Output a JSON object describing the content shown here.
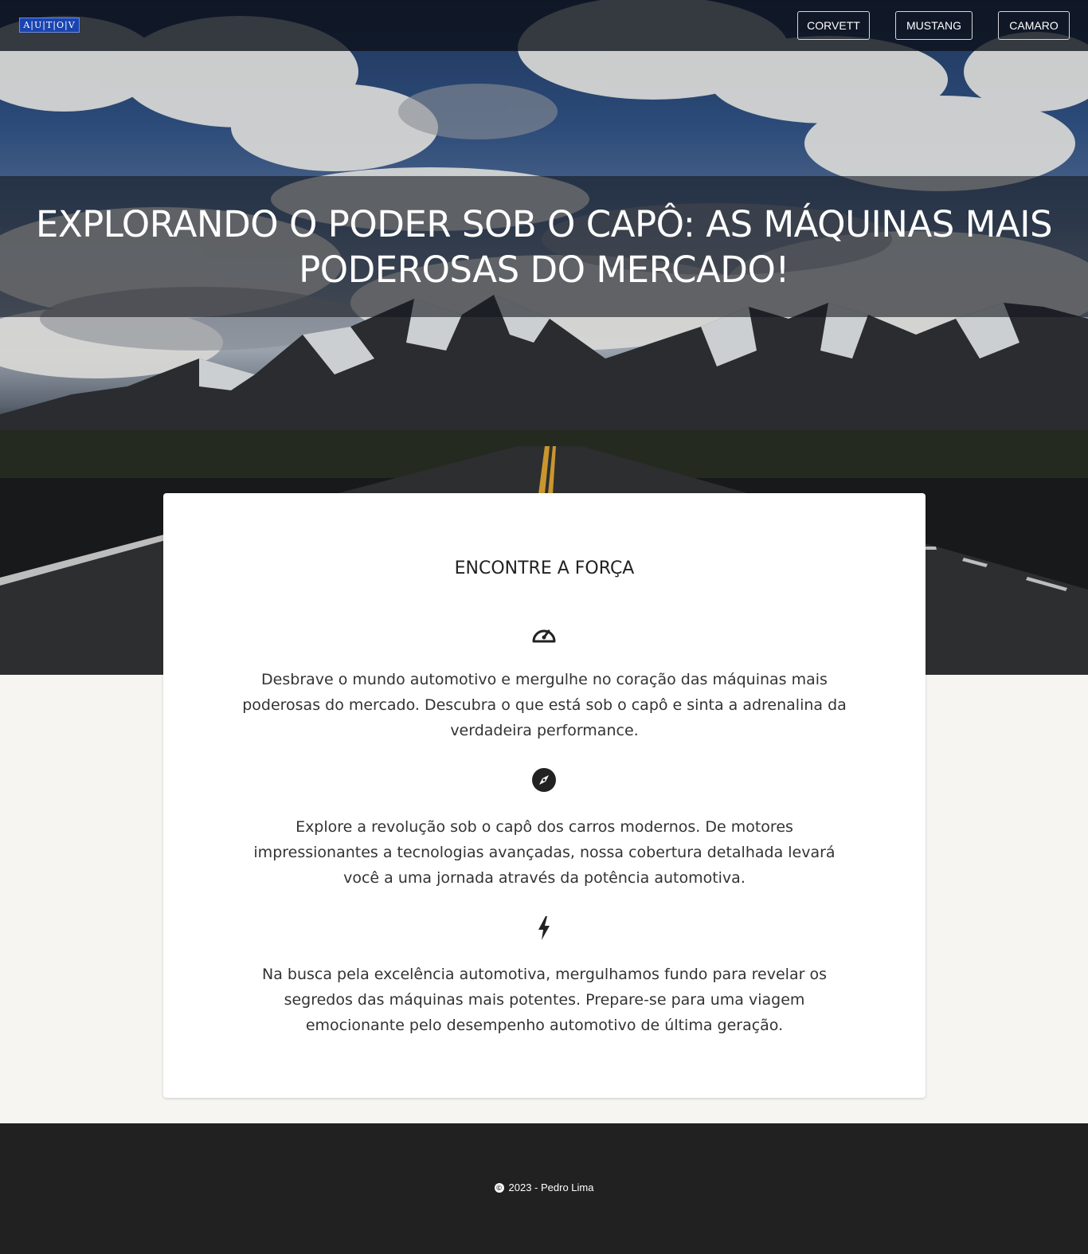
{
  "navbar": {
    "logo_text": "A|U|T|O|V",
    "links": [
      "CORVETT",
      "MUSTANG",
      "CAMARO"
    ]
  },
  "hero": {
    "title": "EXPLORANDO O PODER SOB O CAPÔ: AS MÁQUINAS MAIS PODEROSAS DO MERCADO!"
  },
  "card": {
    "heading": "ENCONTRE A FORÇA",
    "features": [
      {
        "icon": "speedometer-icon",
        "text": "Desbrave o mundo automotivo e mergulhe no coração das máquinas mais poderosas do mercado. Descubra o que está sob o capô e sinta a adrenalina da verdadeira performance."
      },
      {
        "icon": "compass-icon",
        "text": "Explore a revolução sob o capô dos carros modernos. De motores impressionantes a tecnologias avançadas, nossa cobertura detalhada levará você a uma jornada através da potência automotiva."
      },
      {
        "icon": "lightning-icon",
        "text": "Na busca pela excelência automotiva, mergulhamos fundo para revelar os segredos das máquinas mais potentes. Prepare-se para uma viagem emocionante pelo desempenho automotivo de última geração."
      }
    ]
  },
  "footer": {
    "copyright_symbol": "©",
    "copyright": "2023 - Pedro Lima"
  },
  "colors": {
    "footer_bg": "#212121",
    "page_bg": "#f6f5f2",
    "logo_bg": "#1a44b0"
  }
}
